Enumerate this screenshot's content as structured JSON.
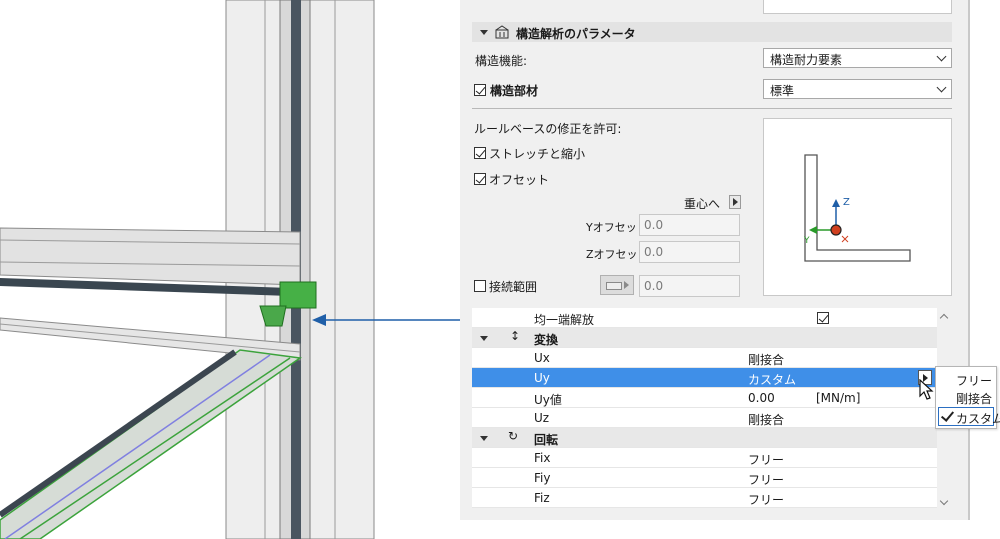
{
  "colors": {
    "accent": "#3f8fe8",
    "arrow": "#1f5fa8",
    "green": "#3ca33c"
  },
  "section": {
    "title": "構造解析のパラメータ",
    "icon": "structural-analysis-icon"
  },
  "structural_function": {
    "label": "構造機能:",
    "value": "構造耐力要素"
  },
  "structural_member": {
    "label": "構造部材",
    "checked": true,
    "value": "標準"
  },
  "rules": {
    "label": "ルールベースの修正を許可:",
    "stretch": {
      "label": "ストレッチと縮小",
      "checked": true
    },
    "offset": {
      "label": "オフセット",
      "checked": true
    },
    "to_center": "重心へ",
    "y_offset": {
      "label": "Yオフセット:",
      "value": "0.0"
    },
    "z_offset": {
      "label": "Zオフセット:",
      "value": "0.0"
    },
    "connection_range": {
      "label": "接続範囲",
      "checked": false,
      "value": "0.0"
    }
  },
  "preview": {
    "axis_z": "Z",
    "axis_y": "Y"
  },
  "table": {
    "uniform_release": {
      "label": "均一端解放",
      "checked": true
    },
    "translation_group": "変換",
    "rotation_group": "回転",
    "rows": [
      {
        "name": "Ux",
        "value": "剛接合",
        "unit": ""
      },
      {
        "name": "Uy",
        "value": "カスタム",
        "unit": ""
      },
      {
        "name": "Uy値",
        "value": "0.00",
        "unit": "[MN/m]"
      },
      {
        "name": "Uz",
        "value": "剛接合",
        "unit": ""
      }
    ],
    "rot_rows": [
      {
        "name": "Fix",
        "value": "フリー"
      },
      {
        "name": "Fiy",
        "value": "フリー"
      },
      {
        "name": "Fiz",
        "value": "フリー"
      }
    ]
  },
  "popup": {
    "options": [
      "フリー",
      "剛接合",
      "カスタム"
    ],
    "selected": "カスタム"
  }
}
